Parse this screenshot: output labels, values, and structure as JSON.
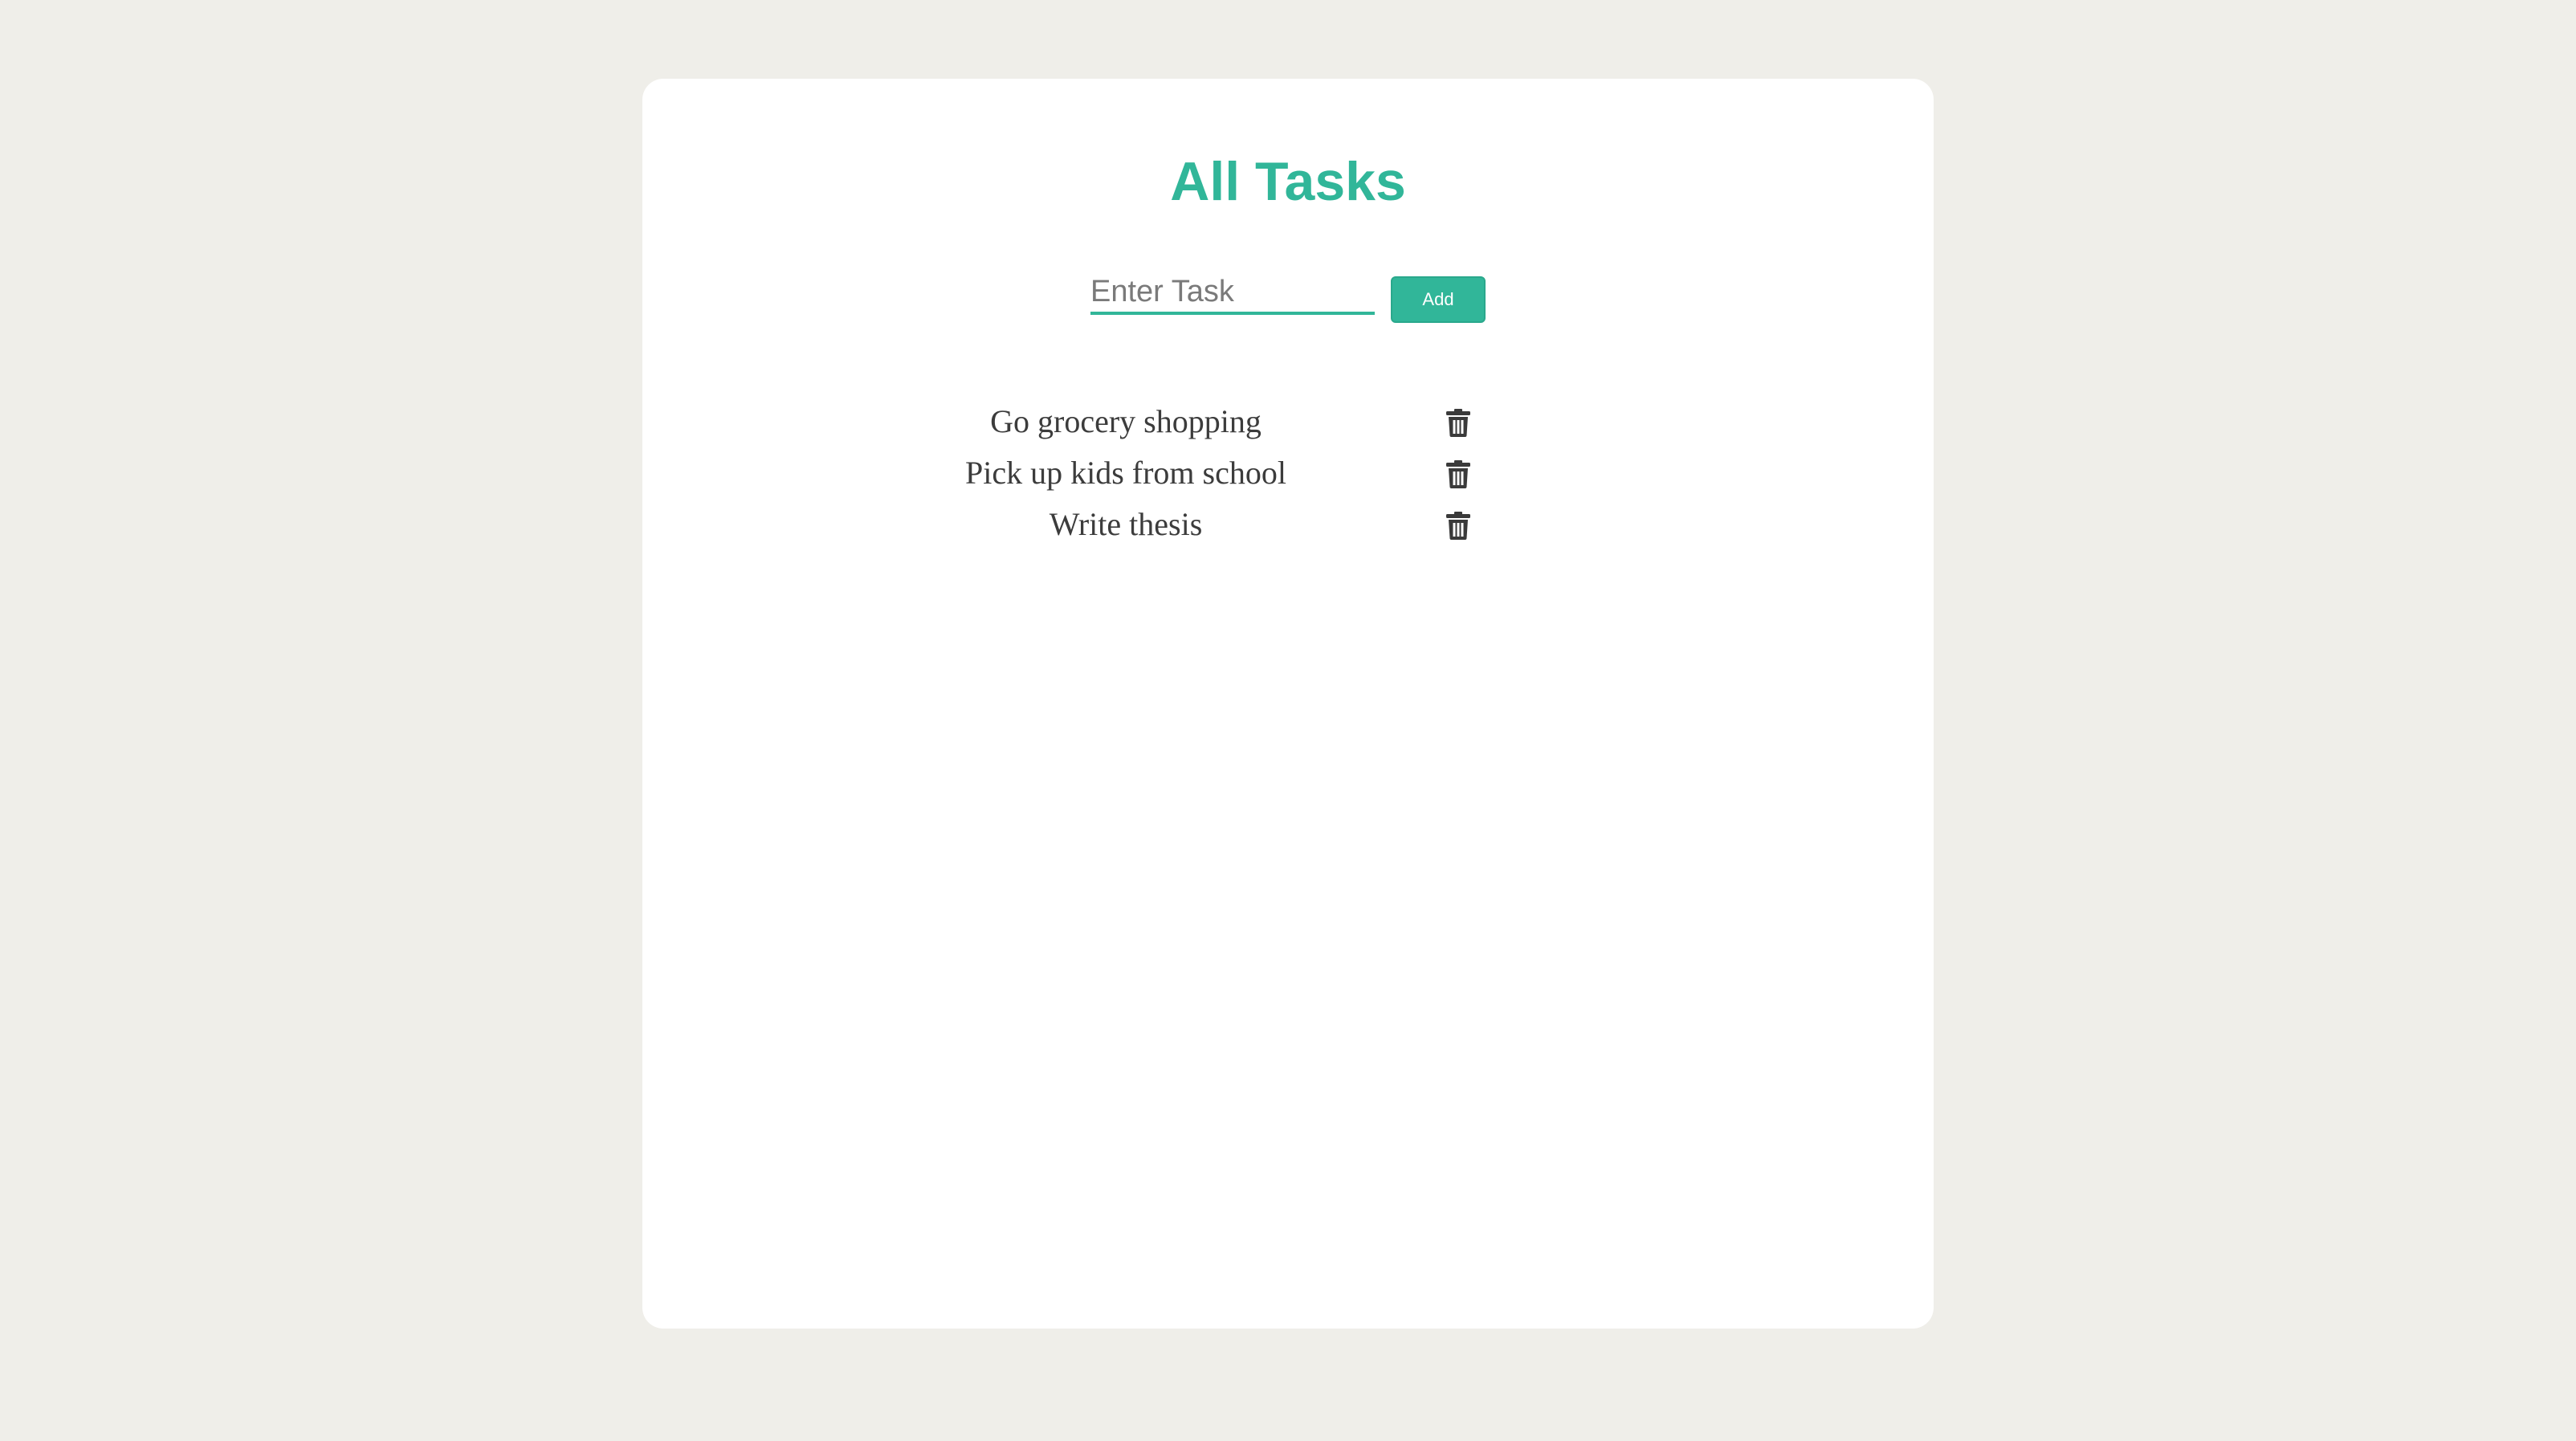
{
  "header": {
    "title": "All Tasks"
  },
  "new_task": {
    "placeholder": "Enter Task",
    "value": "",
    "add_label": "Add"
  },
  "tasks": [
    {
      "text": "Go grocery shopping",
      "delete_icon": "trash-icon"
    },
    {
      "text": "Pick up kids from school",
      "delete_icon": "trash-icon"
    },
    {
      "text": "Write thesis",
      "delete_icon": "trash-icon"
    }
  ],
  "colors": {
    "accent": "#31b699",
    "page_background": "#efeee9",
    "card_background": "#ffffff",
    "task_text": "#3c3c3c",
    "icon": "#3a3a3a"
  }
}
